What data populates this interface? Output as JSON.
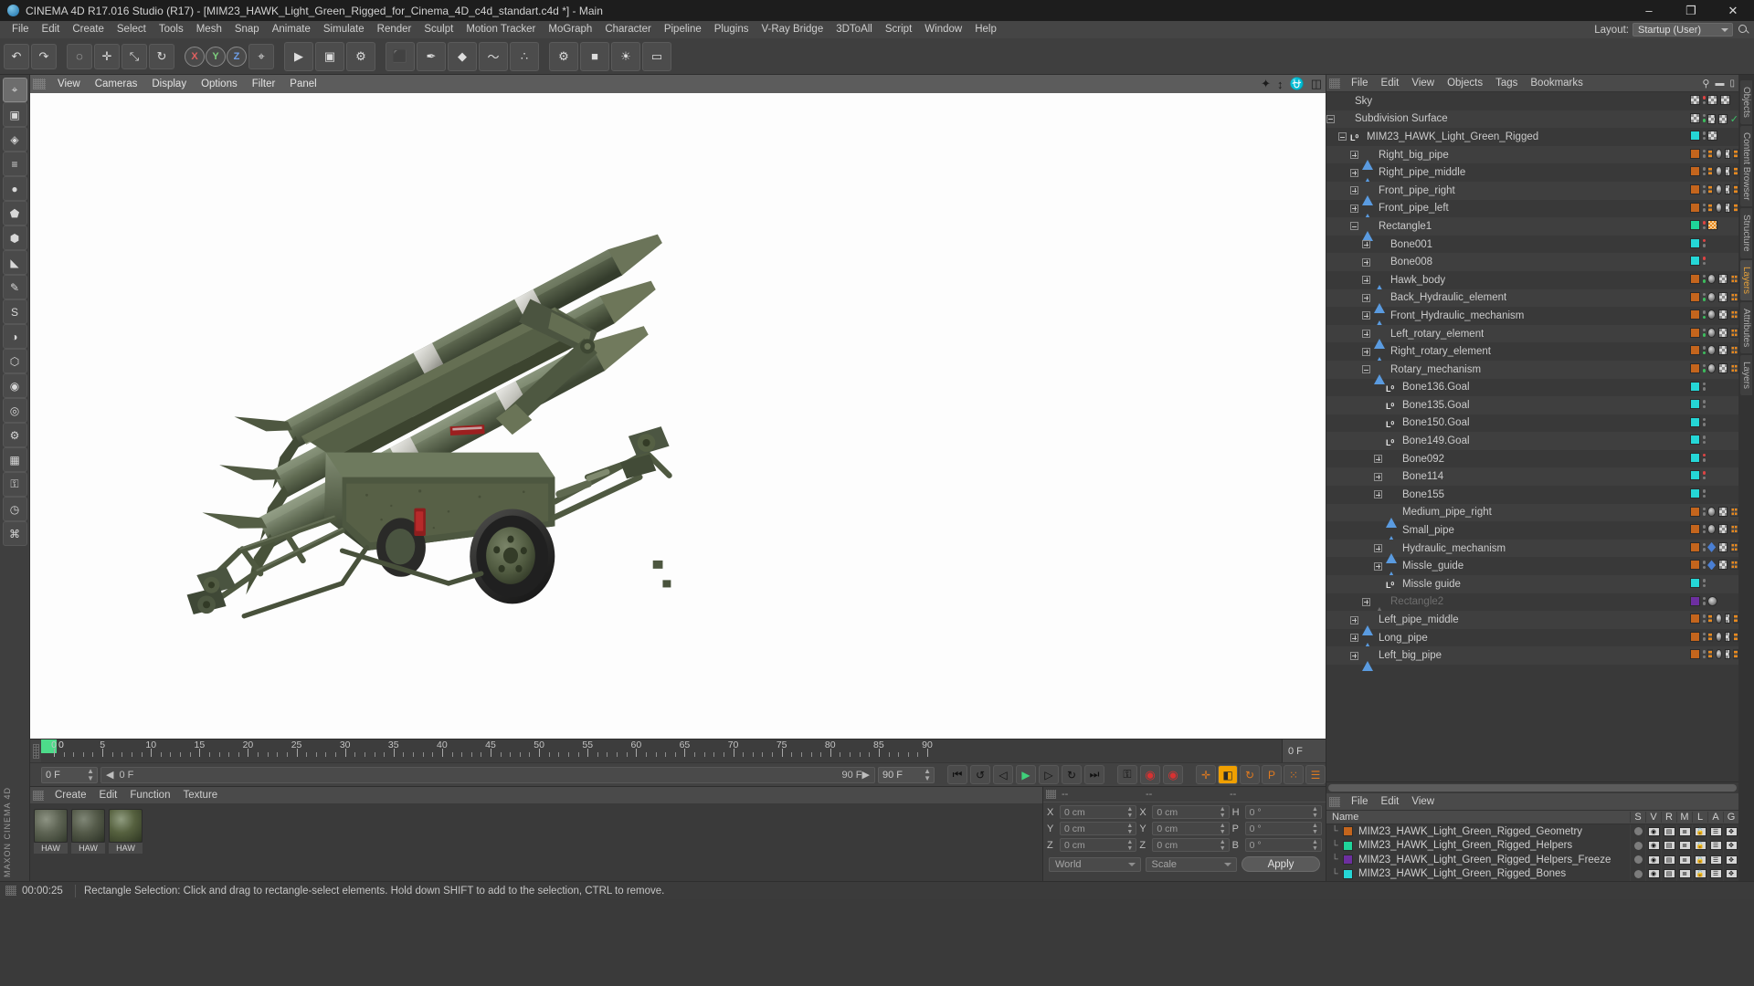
{
  "window": {
    "title": "CINEMA 4D R17.016 Studio (R17) - [MIM23_HAWK_Light_Green_Rigged_for_Cinema_4D_c4d_standart.c4d *] - Main",
    "minimize": "–",
    "maximize": "❐",
    "close": "✕"
  },
  "menubar": {
    "items": [
      "File",
      "Edit",
      "Create",
      "Select",
      "Tools",
      "Mesh",
      "Snap",
      "Animate",
      "Simulate",
      "Render",
      "Sculpt",
      "Motion Tracker",
      "MoGraph",
      "Character",
      "Pipeline",
      "Plugins",
      "V-Ray Bridge",
      "3DToAll",
      "Script",
      "Window",
      "Help"
    ],
    "layout_label": "Layout:",
    "layout_value": "Startup (User)"
  },
  "toolbar": {
    "undo": "↶",
    "redo": "↷",
    "live_selection": "◌",
    "move": "✛",
    "scale": "⤡",
    "rotate": "↻",
    "axis_x": "X",
    "axis_y": "Y",
    "axis_z": "Z",
    "world_axis": "⌖",
    "render_view": "▶",
    "render_region": "▣",
    "render_settings": "⚙",
    "cube": "⬛",
    "spline": "✒",
    "generator": "◆",
    "bend": "〜",
    "array": "∴",
    "scene": "⚙",
    "camera": "■",
    "light": "☀",
    "floor": "▭"
  },
  "lefttools": {
    "items": [
      {
        "icon": "⌖",
        "name": "move-tool"
      },
      {
        "icon": "▣",
        "name": "box-tool"
      },
      {
        "icon": "◈",
        "name": "poly-tool"
      },
      {
        "icon": "≡",
        "name": "edge-tool"
      },
      {
        "icon": "●",
        "name": "point-tool"
      },
      {
        "icon": "⬟",
        "name": "model-tool"
      },
      {
        "icon": "⬢",
        "name": "object-tool"
      },
      {
        "icon": "◣",
        "name": "texture-tool"
      },
      {
        "icon": "✎",
        "name": "brush-tool"
      },
      {
        "icon": "S",
        "name": "snap-tool"
      },
      {
        "icon": "◑",
        "name": "workplane-tool"
      },
      {
        "icon": "⬡",
        "name": "enable-axis"
      },
      {
        "icon": "◉",
        "name": "viewport-solo"
      },
      {
        "icon": "◎",
        "name": "deformer"
      },
      {
        "icon": "⚙",
        "name": "options"
      },
      {
        "icon": "▦",
        "name": "layers"
      },
      {
        "icon": "⚿",
        "name": "lock"
      },
      {
        "icon": "◷",
        "name": "grid"
      },
      {
        "icon": "⌘",
        "name": "snap-settings"
      }
    ],
    "brand": "MAXON CINEMA 4D"
  },
  "viewport": {
    "menu": [
      "View",
      "Cameras",
      "Display",
      "Options",
      "Filter",
      "Panel"
    ],
    "icons": [
      "move-view-icon",
      "zoom-view-icon",
      "rotate-view-icon",
      "layout-view-icon"
    ]
  },
  "timeline": {
    "start_frame": "0 F",
    "end_frame": "90 F",
    "current_frame": "0 F",
    "preview_end": "90 F",
    "right_frame_box": "0 F",
    "ticks": [
      0,
      5,
      10,
      15,
      20,
      25,
      30,
      35,
      40,
      45,
      50,
      55,
      60,
      65,
      70,
      75,
      80,
      85,
      90
    ]
  },
  "transport": {
    "buttons": [
      {
        "name": "go-to-start-button",
        "glyph": "⏮"
      },
      {
        "name": "previous-key-button",
        "glyph": "↺"
      },
      {
        "name": "step-back-button",
        "glyph": "◁"
      },
      {
        "name": "play-button",
        "glyph": "▶"
      },
      {
        "name": "step-forward-button",
        "glyph": "▷"
      },
      {
        "name": "next-key-button",
        "glyph": "↻"
      },
      {
        "name": "go-to-end-button",
        "glyph": "⏭"
      }
    ],
    "record_group": [
      {
        "name": "autokey-button",
        "glyph": "⚿"
      },
      {
        "name": "record-active-objects-button",
        "glyph": "◉"
      },
      {
        "name": "record-keyframe-button",
        "glyph": "◉"
      }
    ],
    "key_group": [
      {
        "name": "key-position-button",
        "glyph": "✛"
      },
      {
        "name": "key-scale-button",
        "glyph": "◧"
      },
      {
        "name": "key-rotation-button",
        "glyph": "↻"
      },
      {
        "name": "key-param-button",
        "glyph": "P"
      },
      {
        "name": "key-pla-button",
        "glyph": "⁙"
      },
      {
        "name": "animation-layout-button",
        "glyph": "☰"
      }
    ]
  },
  "materials": {
    "menu": [
      "Create",
      "Edit",
      "Function",
      "Texture"
    ],
    "items": [
      {
        "label": "HAW",
        "name": "material-hawk-1"
      },
      {
        "label": "HAW",
        "name": "material-hawk-2"
      },
      {
        "label": "HAW",
        "name": "material-hawk-3"
      }
    ]
  },
  "coordinates": {
    "header": [
      "--",
      "--",
      "--"
    ],
    "rows": [
      {
        "l1": "X",
        "v1": "0 cm",
        "l2": "X",
        "v2": "0 cm",
        "l3": "H",
        "v3": "0 °"
      },
      {
        "l1": "Y",
        "v1": "0 cm",
        "l2": "Y",
        "v2": "0 cm",
        "l3": "P",
        "v3": "0 °"
      },
      {
        "l1": "Z",
        "v1": "0 cm",
        "l2": "Z",
        "v2": "0 cm",
        "l3": "B",
        "v3": "0 °"
      }
    ],
    "space": "World",
    "mode": "Scale",
    "apply": "Apply"
  },
  "objectmanager": {
    "menu": [
      "File",
      "Edit",
      "View",
      "Objects",
      "Tags",
      "Bookmarks"
    ],
    "items": [
      {
        "label": "Sky",
        "indent": 0,
        "icon": "sky",
        "exp": "none",
        "swatch": "",
        "tags": [
          "check",
          "dots"
        ],
        "dot": "r"
      },
      {
        "label": "Subdivision Surface",
        "indent": 0,
        "icon": "sds",
        "exp": "minus",
        "swatch": "",
        "tags": [
          "check",
          "dots",
          "tick"
        ],
        "dot": "g"
      },
      {
        "label": "MIM23_HAWK_Light_Green_Rigged",
        "indent": 1,
        "icon": "null",
        "exp": "minus",
        "swatch": "#25d6d6",
        "tags": [
          "dots"
        ],
        "dot": "n"
      },
      {
        "label": "Right_big_pipe",
        "indent": 2,
        "icon": "mesh",
        "exp": "plus",
        "swatch": "#c4651d",
        "tags": [
          "dotgrid",
          "tex",
          "check",
          "dotgrid"
        ],
        "dot": "n"
      },
      {
        "label": "Right_pipe_middle",
        "indent": 2,
        "icon": "mesh",
        "exp": "plus",
        "swatch": "#c4651d",
        "tags": [
          "dotgrid",
          "tex",
          "check",
          "dotgrid"
        ],
        "dot": "n"
      },
      {
        "label": "Front_pipe_right",
        "indent": 2,
        "icon": "mesh",
        "exp": "plus",
        "swatch": "#c4651d",
        "tags": [
          "dotgrid",
          "tex",
          "check",
          "dotgrid"
        ],
        "dot": "n"
      },
      {
        "label": "Front_pipe_left",
        "indent": 2,
        "icon": "mesh",
        "exp": "plus",
        "swatch": "#c4651d",
        "tags": [
          "dotgrid",
          "tex",
          "check",
          "dotgrid"
        ],
        "dot": "n"
      },
      {
        "label": "Rectangle1",
        "indent": 2,
        "icon": "mesh",
        "exp": "minus",
        "swatch": "#1fd49a",
        "tags": [
          "orangedot"
        ],
        "dot": "r"
      },
      {
        "label": "Bone001",
        "indent": 3,
        "icon": "bone",
        "exp": "plus",
        "swatch": "#25d6d6",
        "tags": [],
        "dot": "r"
      },
      {
        "label": "Bone008",
        "indent": 3,
        "icon": "bone",
        "exp": "plus",
        "swatch": "#25d6d6",
        "tags": [],
        "dot": "r"
      },
      {
        "label": "Hawk_body",
        "indent": 3,
        "icon": "mesh",
        "exp": "plus",
        "swatch": "#c4651d",
        "tags": [
          "tex",
          "check",
          "dotgrid"
        ],
        "dot": "g"
      },
      {
        "label": "Back_Hydraulic_element",
        "indent": 3,
        "icon": "mesh",
        "exp": "plus",
        "swatch": "#c4651d",
        "tags": [
          "tex",
          "check",
          "dotgrid"
        ],
        "dot": "g"
      },
      {
        "label": "Front_Hydraulic_mechanism",
        "indent": 3,
        "icon": "mesh",
        "exp": "plus",
        "swatch": "#c4651d",
        "tags": [
          "tex",
          "check",
          "dotgrid"
        ],
        "dot": "g"
      },
      {
        "label": "Left_rotary_element",
        "indent": 3,
        "icon": "mesh",
        "exp": "plus",
        "swatch": "#c4651d",
        "tags": [
          "tex",
          "check",
          "dotgrid"
        ],
        "dot": "g"
      },
      {
        "label": "Right_rotary_element",
        "indent": 3,
        "icon": "mesh",
        "exp": "plus",
        "swatch": "#c4651d",
        "tags": [
          "tex",
          "check",
          "dotgrid"
        ],
        "dot": "g"
      },
      {
        "label": "Rotary_mechanism",
        "indent": 3,
        "icon": "mesh",
        "exp": "minus",
        "swatch": "#c4651d",
        "tags": [
          "tex",
          "check",
          "dotgrid"
        ],
        "dot": "g"
      },
      {
        "label": "Bone136.Goal",
        "indent": 4,
        "icon": "null",
        "exp": "none",
        "swatch": "#25d6d6",
        "tags": [],
        "dot": "n"
      },
      {
        "label": "Bone135.Goal",
        "indent": 4,
        "icon": "null",
        "exp": "none",
        "swatch": "#25d6d6",
        "tags": [],
        "dot": "n"
      },
      {
        "label": "Bone150.Goal",
        "indent": 4,
        "icon": "null",
        "exp": "none",
        "swatch": "#25d6d6",
        "tags": [],
        "dot": "n"
      },
      {
        "label": "Bone149.Goal",
        "indent": 4,
        "icon": "null",
        "exp": "none",
        "swatch": "#25d6d6",
        "tags": [],
        "dot": "n"
      },
      {
        "label": "Bone092",
        "indent": 4,
        "icon": "bone",
        "exp": "plus",
        "swatch": "#25d6d6",
        "tags": [],
        "dot": "r"
      },
      {
        "label": "Bone114",
        "indent": 4,
        "icon": "bone",
        "exp": "plus",
        "swatch": "#25d6d6",
        "tags": [],
        "dot": "r"
      },
      {
        "label": "Bone155",
        "indent": 4,
        "icon": "bone",
        "exp": "plus",
        "swatch": "#25d6d6",
        "tags": [],
        "dot": "n"
      },
      {
        "label": "Medium_pipe_right",
        "indent": 4,
        "icon": "mesh",
        "exp": "none",
        "swatch": "#c4651d",
        "tags": [
          "tex",
          "check",
          "dotgrid"
        ],
        "dot": "n"
      },
      {
        "label": "Small_pipe",
        "indent": 4,
        "icon": "mesh",
        "exp": "none",
        "swatch": "#c4651d",
        "tags": [
          "tex",
          "check",
          "dotgrid"
        ],
        "dot": "n"
      },
      {
        "label": "Hydraulic_mechanism",
        "indent": 4,
        "icon": "mesh",
        "exp": "plus",
        "swatch": "#c4651d",
        "tags": [
          "blue",
          "check",
          "dotgrid"
        ],
        "dot": "n"
      },
      {
        "label": "Missle_guide",
        "indent": 4,
        "icon": "mesh",
        "exp": "plus",
        "swatch": "#c4651d",
        "tags": [
          "bluesm",
          "check",
          "dotgrid"
        ],
        "dot": "n"
      },
      {
        "label": "Missle guide",
        "indent": 4,
        "icon": "null",
        "exp": "none",
        "swatch": "#25d6d6",
        "tags": [],
        "dot": "n"
      },
      {
        "label": "Rectangle2",
        "indent": 3,
        "icon": "meshoff",
        "exp": "plus",
        "swatch": "#6d2fa0",
        "tags": [
          "tex"
        ],
        "dot": "n",
        "dim": true
      },
      {
        "label": "Left_pipe_middle",
        "indent": 2,
        "icon": "mesh",
        "exp": "plus",
        "swatch": "#c4651d",
        "tags": [
          "dotgrid",
          "tex",
          "check",
          "dotgrid"
        ],
        "dot": "n"
      },
      {
        "label": "Long_pipe",
        "indent": 2,
        "icon": "mesh",
        "exp": "plus",
        "swatch": "#c4651d",
        "tags": [
          "dotgrid",
          "tex",
          "check",
          "dotgrid"
        ],
        "dot": "n"
      },
      {
        "label": "Left_big_pipe",
        "indent": 2,
        "icon": "mesh",
        "exp": "plus",
        "swatch": "#c4651d",
        "tags": [
          "dotgrid",
          "tex",
          "check",
          "dotgrid"
        ],
        "dot": "n"
      }
    ]
  },
  "layermanager": {
    "menu": [
      "File",
      "Edit",
      "View"
    ],
    "columns": [
      "Name",
      "S",
      "V",
      "R",
      "M",
      "L",
      "A",
      "G"
    ],
    "rows": [
      {
        "name": "MIM23_HAWK_Light_Green_Rigged_Geometry",
        "color": "#c4651d",
        "locked": false
      },
      {
        "name": "MIM23_HAWK_Light_Green_Rigged_Helpers",
        "color": "#1fd49a",
        "locked": false
      },
      {
        "name": "MIM23_HAWK_Light_Green_Rigged_Helpers_Freeze",
        "color": "#6d2fa0",
        "locked": true
      },
      {
        "name": "MIM23_HAWK_Light_Green_Rigged_Bones",
        "color": "#25d6d6",
        "locked": false
      }
    ]
  },
  "vtabs": [
    "Objects",
    "Content Browser",
    "Structure",
    "Layers",
    "Attributes",
    "Layers"
  ],
  "statusbar": {
    "time": "00:00:25",
    "message": "Rectangle Selection: Click and drag to rectangle-select elements. Hold down SHIFT to add to the selection, CTRL to remove."
  },
  "colors": {
    "geometry": "#c4651d",
    "helpers": "#1fd49a",
    "freeze": "#6d2fa0",
    "bones": "#25d6d6",
    "accent_green": "#4ddb8a",
    "accent_orange": "#e8a33a"
  }
}
